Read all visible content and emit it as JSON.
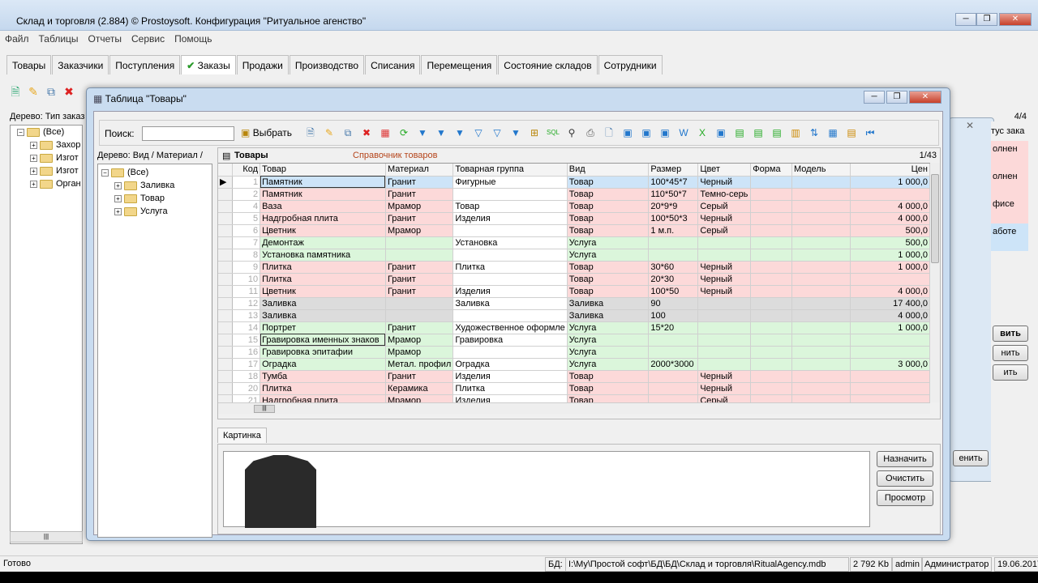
{
  "window": {
    "title": "Склад и торговля (2.884) © Prostoysoft. Конфигурация \"Ритуальное агенство\""
  },
  "menu": [
    "Файл",
    "Таблицы",
    "Отчеты",
    "Сервис",
    "Помощь"
  ],
  "tabs": [
    "Товары",
    "Заказчики",
    "Поступления",
    "Заказы",
    "Продажи",
    "Производство",
    "Списания",
    "Перемещения",
    "Состояние складов",
    "Сотрудники"
  ],
  "active_tab": "Заказы",
  "background": {
    "tree_label": "Дерево: Тип заказ",
    "tree_items": [
      "(Все)",
      "Захор",
      "Изгот",
      "Изгот",
      "Орган"
    ],
    "page_count": "4/4",
    "column_header": "тус зака",
    "cells": [
      "олнен",
      "олнен",
      "фисе",
      "аботе"
    ],
    "buttons": [
      "вить",
      "нить",
      "ить",
      "енить"
    ]
  },
  "dialog": {
    "title": "Таблица \"Товары\"",
    "search_label": "Поиск:",
    "search_value": "",
    "pick_button": "Выбрать",
    "tree_label": "Дерево: Вид / Материал / ...",
    "tree": [
      "(Все)",
      "Заливка",
      "Товар",
      "Услуга"
    ],
    "grid_title": "Товары",
    "grid_subtitle": "Справочник товаров",
    "record_counter": "1/43",
    "columns": [
      "Код",
      "Товар",
      "Материал",
      "Товарная группа",
      "Вид",
      "Размер",
      "Цвет",
      "Форма",
      "Модель",
      "Цен"
    ],
    "rows": [
      {
        "kind": "sel",
        "code": "1",
        "name": "Памятник",
        "material": "Гранит",
        "group": "Фигурные",
        "type": "Товар",
        "size": "100*45*7",
        "color": "Черный",
        "form": "",
        "model": "",
        "price": "1 000,0"
      },
      {
        "kind": "p",
        "code": "2",
        "name": "Памятник",
        "material": "Гранит",
        "group": "",
        "type": "Товар",
        "size": "110*50*7",
        "color": "Темно-серь",
        "form": "",
        "model": "",
        "price": ""
      },
      {
        "kind": "p",
        "code": "4",
        "name": "Ваза",
        "material": "Мрамор",
        "group": "Товар",
        "type": "Товар",
        "size": "20*9*9",
        "color": "Серый",
        "form": "",
        "model": "",
        "price": "4 000,0"
      },
      {
        "kind": "p",
        "code": "5",
        "name": "Надгробная плита",
        "material": "Гранит",
        "group": "Изделия",
        "type": "Товар",
        "size": "100*50*3",
        "color": "Черный",
        "form": "",
        "model": "",
        "price": "4 000,0"
      },
      {
        "kind": "p",
        "code": "6",
        "name": "Цветник",
        "material": "Мрамор",
        "group": "",
        "type": "Товар",
        "size": "1 м.п.",
        "color": "Серый",
        "form": "",
        "model": "",
        "price": "500,0"
      },
      {
        "kind": "g",
        "code": "7",
        "name": "Демонтаж",
        "material": "",
        "group": "Установка",
        "type": "Услуга",
        "size": "",
        "color": "",
        "form": "",
        "model": "",
        "price": "500,0"
      },
      {
        "kind": "g",
        "code": "8",
        "name": "Установка памятника",
        "material": "",
        "group": "",
        "type": "Услуга",
        "size": "",
        "color": "",
        "form": "",
        "model": "",
        "price": "1 000,0"
      },
      {
        "kind": "p",
        "code": "9",
        "name": "Плитка",
        "material": "Гранит",
        "group": "Плитка",
        "type": "Товар",
        "size": "30*60",
        "color": "Черный",
        "form": "",
        "model": "",
        "price": "1 000,0"
      },
      {
        "kind": "p",
        "code": "10",
        "name": "Плитка",
        "material": "Гранит",
        "group": "",
        "type": "Товар",
        "size": "20*30",
        "color": "Черный",
        "form": "",
        "model": "",
        "price": ""
      },
      {
        "kind": "p",
        "code": "11",
        "name": "Цветник",
        "material": "Гранит",
        "group": "Изделия",
        "type": "Товар",
        "size": "100*50",
        "color": "Черный",
        "form": "",
        "model": "",
        "price": "4 000,0"
      },
      {
        "kind": "x",
        "code": "12",
        "name": "Заливка",
        "material": "",
        "group": "Заливка",
        "type": "Заливка",
        "size": "90",
        "color": "",
        "form": "",
        "model": "",
        "price": "17 400,0"
      },
      {
        "kind": "x",
        "code": "13",
        "name": "Заливка",
        "material": "",
        "group": "",
        "type": "Заливка",
        "size": "100",
        "color": "",
        "form": "",
        "model": "",
        "price": "4 000,0"
      },
      {
        "kind": "g",
        "code": "14",
        "name": "Портрет",
        "material": "Гранит",
        "group": "Художественное оформле",
        "type": "Услуга",
        "size": "15*20",
        "color": "",
        "form": "",
        "model": "",
        "price": "1 000,0"
      },
      {
        "kind": "g",
        "code": "15",
        "name": "Гравировка именных знаков",
        "material": "Мрамор",
        "group": "Гравировка",
        "type": "Услуга",
        "size": "",
        "color": "",
        "form": "",
        "model": "",
        "price": ""
      },
      {
        "kind": "g",
        "code": "16",
        "name": "Гравировка эпитафии",
        "material": "Мрамор",
        "group": "",
        "type": "Услуга",
        "size": "",
        "color": "",
        "form": "",
        "model": "",
        "price": ""
      },
      {
        "kind": "g",
        "code": "17",
        "name": "Оградка",
        "material": "Метал. профил",
        "group": "Оградка",
        "type": "Услуга",
        "size": "2000*3000",
        "color": "",
        "form": "",
        "model": "",
        "price": "3 000,0"
      },
      {
        "kind": "p",
        "code": "18",
        "name": "Тумба",
        "material": "Гранит",
        "group": "Изделия",
        "type": "Товар",
        "size": "",
        "color": "Черный",
        "form": "",
        "model": "",
        "price": ""
      },
      {
        "kind": "p",
        "code": "20",
        "name": "Плитка",
        "material": "Керамика",
        "group": "Плитка",
        "type": "Товар",
        "size": "",
        "color": "Черный",
        "form": "",
        "model": "",
        "price": ""
      },
      {
        "kind": "p",
        "code": "21",
        "name": "Надгробная плита",
        "material": "Мрамор",
        "group": "Изделия",
        "type": "Товар",
        "size": "",
        "color": "Серый",
        "form": "",
        "model": "",
        "price": ""
      }
    ],
    "picture_tab": "Картинка",
    "buttons": {
      "assign": "Назначить",
      "clear": "Очистить",
      "view": "Просмотр"
    }
  },
  "status": {
    "text": "Готово",
    "db_label": "БД:",
    "db_path": "I:\\Мy\\Простой софт\\БД\\БД\\Склад и торговля\\RitualAgency.mdb",
    "size": "2 792 Kb",
    "user": "admin",
    "role": "Администратор",
    "date": "19.06.2017"
  },
  "colors": {
    "row_product": "#fcd9d9",
    "row_service": "#dbf6db",
    "row_fill": "#dcdcdc",
    "row_selected": "#cde4f8",
    "subtitle": "#b5451b"
  }
}
